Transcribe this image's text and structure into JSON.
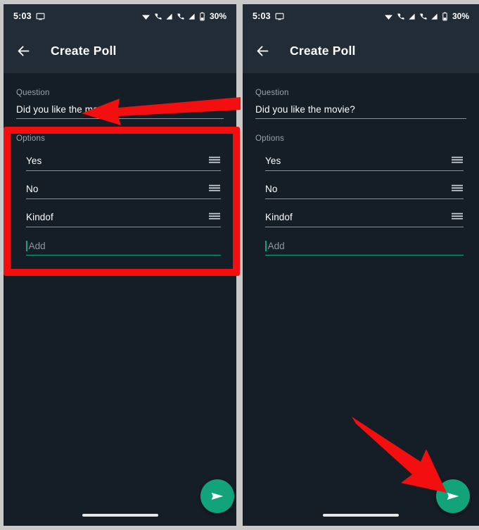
{
  "meta": {
    "app": "WhatsApp Create Poll",
    "accent_green": "#12a37a",
    "annotation_red": "#f30f0f",
    "background": "#151d27",
    "appbar_background": "#212c36"
  },
  "status_bar": {
    "time": "5:03",
    "screen_icon": "monitor-icon",
    "wifi_icon": "wifi-icon",
    "signal_icons": [
      "cellular-call-icon",
      "signal-bars-icon",
      "cellular-call-icon",
      "signal-bars-icon"
    ],
    "battery_icon": "battery-icon",
    "battery_level": "30%"
  },
  "appbar": {
    "back_icon": "back-arrow-icon",
    "title": "Create Poll"
  },
  "form": {
    "question_label": "Question",
    "question_value": "Did you like the movie?",
    "options_label": "Options",
    "options": [
      {
        "value": "Yes",
        "handle_icon": "drag-handle-icon"
      },
      {
        "value": "No",
        "handle_icon": "drag-handle-icon"
      },
      {
        "value": "Kindof",
        "handle_icon": "drag-handle-icon"
      }
    ],
    "add_placeholder": "Add"
  },
  "fab": {
    "icon": "send-icon",
    "label": "Send"
  },
  "navigation": {
    "gesture_pill": "home-gesture-pill"
  },
  "annotations": {
    "box": "highlight-options-section",
    "arrow_left": "arrow-pointing-to-question-field",
    "arrow_right": "arrow-pointing-to-send-button"
  }
}
